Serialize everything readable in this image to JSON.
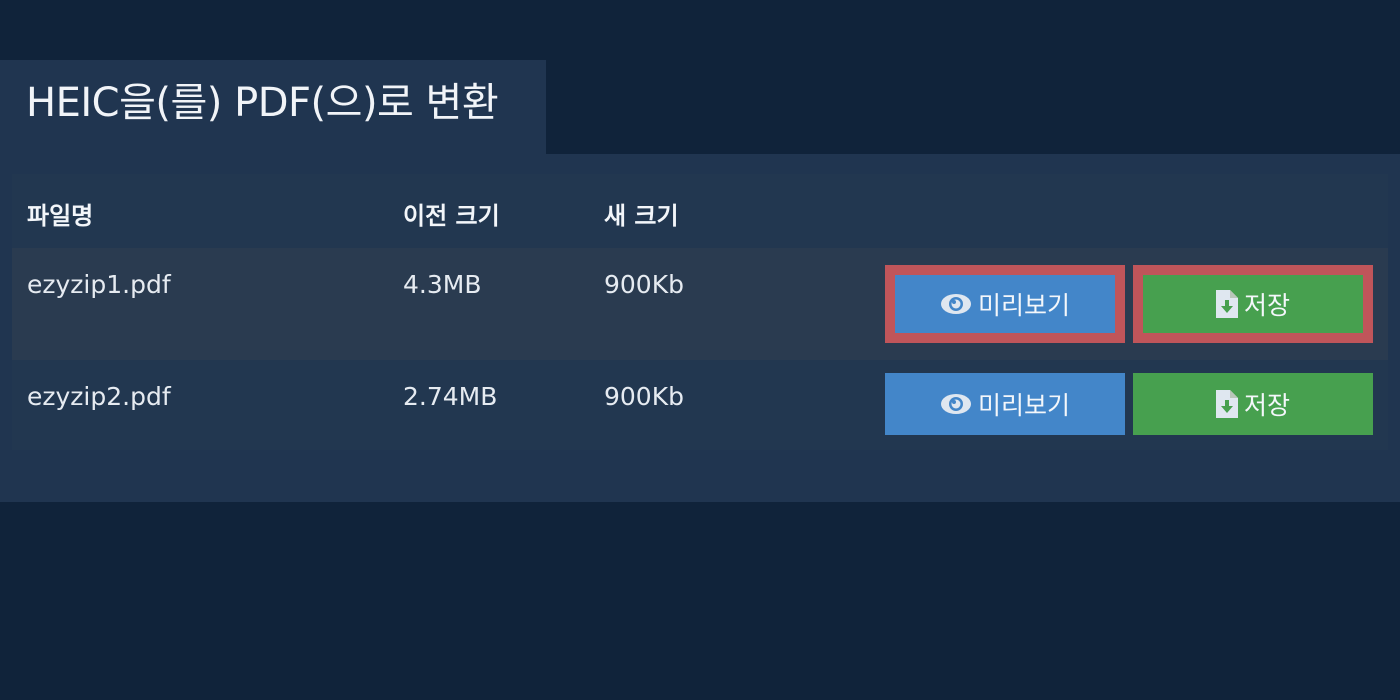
{
  "page_title": "HEIC을(를) PDF(으)로 변환",
  "table": {
    "headers": {
      "filename": "파일명",
      "old_size": "이전 크기",
      "new_size": "새 크기"
    },
    "rows": [
      {
        "filename": "ezyzip1.pdf",
        "old_size": "4.3MB",
        "new_size": "900Kb",
        "preview_label": "미리보기",
        "save_label": "저장"
      },
      {
        "filename": "ezyzip2.pdf",
        "old_size": "2.74MB",
        "new_size": "900Kb",
        "preview_label": "미리보기",
        "save_label": "저장"
      }
    ]
  },
  "colors": {
    "background": "#10233a",
    "panel": "#203550",
    "preview_button": "#4386c9",
    "save_button": "#47a04f",
    "highlight_border": "#c0555a"
  },
  "icons": {
    "preview": "eye-icon",
    "save": "file-download-icon"
  }
}
